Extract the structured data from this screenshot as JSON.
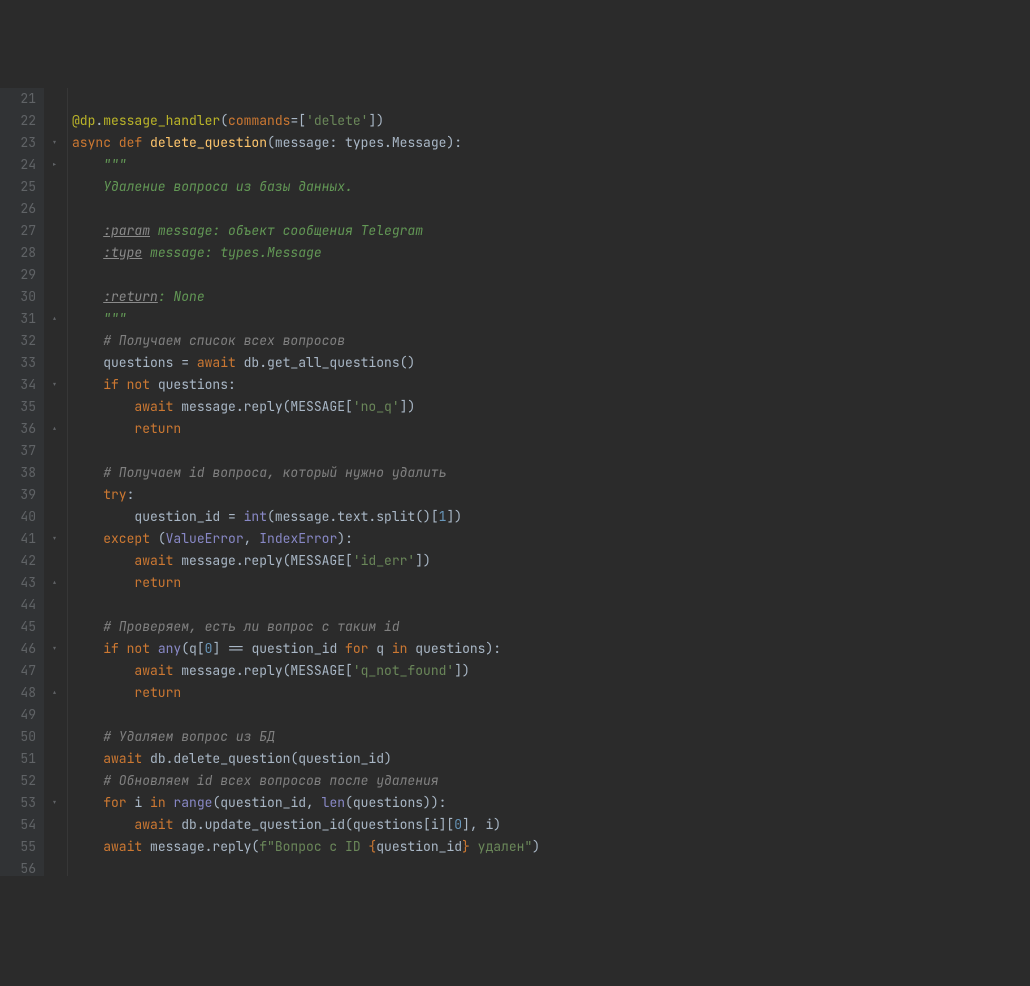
{
  "line_start": 21,
  "line_count": 36,
  "code_lines": [
    {
      "indent": 0,
      "tokens": []
    },
    {
      "indent": 0,
      "tokens": [
        {
          "t": "@dp",
          "c": "decorator"
        },
        {
          "t": ".",
          "c": "op"
        },
        {
          "t": "message_handler",
          "c": "decorator"
        },
        {
          "t": "(",
          "c": "op"
        },
        {
          "t": "commands",
          "c": "kw"
        },
        {
          "t": "=[",
          "c": "op"
        },
        {
          "t": "'delete'",
          "c": "str"
        },
        {
          "t": "])",
          "c": "op"
        }
      ]
    },
    {
      "indent": 0,
      "tokens": [
        {
          "t": "async def ",
          "c": "kw"
        },
        {
          "t": "delete_question",
          "c": "def"
        },
        {
          "t": "(",
          "c": "op"
        },
        {
          "t": "message",
          "c": "param"
        },
        {
          "t": ": types.Message):",
          "c": "op"
        }
      ]
    },
    {
      "indent": 1,
      "tokens": [
        {
          "t": "\"\"\"",
          "c": "docq"
        }
      ]
    },
    {
      "indent": 1,
      "tokens": [
        {
          "t": "Удаление вопроса из базы данных.",
          "c": "docq"
        }
      ]
    },
    {
      "indent": 1,
      "tokens": []
    },
    {
      "indent": 1,
      "tokens": [
        {
          "t": ":param",
          "c": "doctag"
        },
        {
          "t": " message: объект сообщения Telegram",
          "c": "docq"
        }
      ]
    },
    {
      "indent": 1,
      "tokens": [
        {
          "t": ":type",
          "c": "doctag"
        },
        {
          "t": " message: types.Message",
          "c": "docq"
        }
      ]
    },
    {
      "indent": 1,
      "tokens": []
    },
    {
      "indent": 1,
      "tokens": [
        {
          "t": ":return",
          "c": "doctag"
        },
        {
          "t": ": None",
          "c": "docq"
        }
      ]
    },
    {
      "indent": 1,
      "tokens": [
        {
          "t": "\"\"\"",
          "c": "docq"
        }
      ]
    },
    {
      "indent": 1,
      "tokens": [
        {
          "t": "# Получаем список всех вопросов",
          "c": "comment"
        }
      ]
    },
    {
      "indent": 1,
      "tokens": [
        {
          "t": "questions = ",
          "c": "op"
        },
        {
          "t": "await ",
          "c": "kw"
        },
        {
          "t": "db.get_all_questions()",
          "c": "op"
        }
      ]
    },
    {
      "indent": 1,
      "tokens": [
        {
          "t": "if not ",
          "c": "kw"
        },
        {
          "t": "questions:",
          "c": "op"
        }
      ]
    },
    {
      "indent": 2,
      "tokens": [
        {
          "t": "await ",
          "c": "kw"
        },
        {
          "t": "message.reply(MESSAGE[",
          "c": "op"
        },
        {
          "t": "'no_q'",
          "c": "str"
        },
        {
          "t": "])",
          "c": "op"
        }
      ]
    },
    {
      "indent": 2,
      "tokens": [
        {
          "t": "return",
          "c": "kw"
        }
      ]
    },
    {
      "indent": 0,
      "tokens": []
    },
    {
      "indent": 1,
      "tokens": [
        {
          "t": "# Получаем id вопроса, который нужно удалить",
          "c": "comment"
        }
      ]
    },
    {
      "indent": 1,
      "tokens": [
        {
          "t": "try",
          "c": "kw"
        },
        {
          "t": ":",
          "c": "op"
        }
      ]
    },
    {
      "indent": 2,
      "tokens": [
        {
          "t": "question_id = ",
          "c": "op"
        },
        {
          "t": "int",
          "c": "builtin"
        },
        {
          "t": "(message.text.split()[",
          "c": "op"
        },
        {
          "t": "1",
          "c": "num"
        },
        {
          "t": "])",
          "c": "op"
        }
      ]
    },
    {
      "indent": 1,
      "tokens": [
        {
          "t": "except ",
          "c": "kw"
        },
        {
          "t": "(",
          "c": "op"
        },
        {
          "t": "ValueError",
          "c": "builtin"
        },
        {
          "t": ", ",
          "c": "op"
        },
        {
          "t": "IndexError",
          "c": "builtin"
        },
        {
          "t": "):",
          "c": "op"
        }
      ]
    },
    {
      "indent": 2,
      "tokens": [
        {
          "t": "await ",
          "c": "kw"
        },
        {
          "t": "message.reply(MESSAGE[",
          "c": "op"
        },
        {
          "t": "'id_err'",
          "c": "str"
        },
        {
          "t": "])",
          "c": "op"
        }
      ]
    },
    {
      "indent": 2,
      "tokens": [
        {
          "t": "return",
          "c": "kw"
        }
      ]
    },
    {
      "indent": 0,
      "tokens": []
    },
    {
      "indent": 1,
      "tokens": [
        {
          "t": "# Проверяем, есть ли вопрос с таким id",
          "c": "comment"
        }
      ]
    },
    {
      "indent": 1,
      "tokens": [
        {
          "t": "if not ",
          "c": "kw"
        },
        {
          "t": "any",
          "c": "builtin"
        },
        {
          "t": "(q[",
          "c": "op"
        },
        {
          "t": "0",
          "c": "num"
        },
        {
          "t": "] == question_id ",
          "c": "op"
        },
        {
          "t": "for ",
          "c": "kw"
        },
        {
          "t": "q ",
          "c": "op"
        },
        {
          "t": "in ",
          "c": "kw"
        },
        {
          "t": "questions):",
          "c": "op"
        }
      ]
    },
    {
      "indent": 2,
      "tokens": [
        {
          "t": "await ",
          "c": "kw"
        },
        {
          "t": "message.reply(MESSAGE[",
          "c": "op"
        },
        {
          "t": "'q_not_found'",
          "c": "str"
        },
        {
          "t": "])",
          "c": "op"
        }
      ]
    },
    {
      "indent": 2,
      "tokens": [
        {
          "t": "return",
          "c": "kw"
        }
      ]
    },
    {
      "indent": 0,
      "tokens": []
    },
    {
      "indent": 1,
      "tokens": [
        {
          "t": "# Удаляем вопрос из БД",
          "c": "comment"
        }
      ]
    },
    {
      "indent": 1,
      "tokens": [
        {
          "t": "await ",
          "c": "kw"
        },
        {
          "t": "db.delete_question(question_id)",
          "c": "op"
        }
      ]
    },
    {
      "indent": 1,
      "tokens": [
        {
          "t": "# Обновляем id всех вопросов после удаления",
          "c": "comment"
        }
      ]
    },
    {
      "indent": 1,
      "tokens": [
        {
          "t": "for ",
          "c": "kw"
        },
        {
          "t": "i ",
          "c": "op"
        },
        {
          "t": "in ",
          "c": "kw"
        },
        {
          "t": "range",
          "c": "builtin"
        },
        {
          "t": "(question_id, ",
          "c": "op"
        },
        {
          "t": "len",
          "c": "builtin"
        },
        {
          "t": "(questions)):",
          "c": "op"
        }
      ]
    },
    {
      "indent": 2,
      "tokens": [
        {
          "t": "await ",
          "c": "kw"
        },
        {
          "t": "db.update_question_id(questions[i][",
          "c": "op"
        },
        {
          "t": "0",
          "c": "num"
        },
        {
          "t": "], i)",
          "c": "op"
        }
      ]
    },
    {
      "indent": 1,
      "tokens": [
        {
          "t": "await ",
          "c": "kw"
        },
        {
          "t": "message.reply(",
          "c": "op"
        },
        {
          "t": "f\"Вопрос с ID ",
          "c": "str"
        },
        {
          "t": "{",
          "c": "fstr-brace"
        },
        {
          "t": "question_id",
          "c": "fstr-var"
        },
        {
          "t": "}",
          "c": "fstr-brace"
        },
        {
          "t": " удален\"",
          "c": "str"
        },
        {
          "t": ")",
          "c": "op"
        }
      ]
    },
    {
      "indent": 0,
      "tokens": []
    }
  ],
  "fold_marks": {
    "23": "▾",
    "24": "▸",
    "31": "▴",
    "34": "▾",
    "36": "▴",
    "41": "▾",
    "43": "▴",
    "46": "▾",
    "48": "▴",
    "53": "▾"
  }
}
